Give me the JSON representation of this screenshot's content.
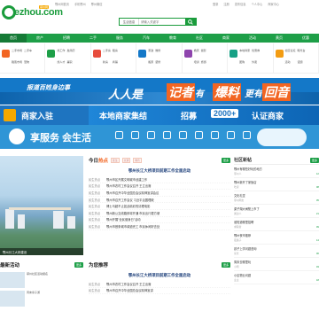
{
  "header": {
    "logo_text": "ezhou.com",
    "logo_tag": "鄂州网",
    "top_left": [
      "鄂州网首页",
      "手机鄂州",
      "鄂州微信"
    ],
    "top_right": [
      "登录",
      "注册",
      "发布信息",
      "个人中心",
      "商家中心"
    ]
  },
  "search": {
    "scope": "生活信息",
    "placeholder": "请输入关键字",
    "button_icon": "search-icon"
  },
  "nav": {
    "items": [
      "首页",
      "房产",
      "招聘",
      "二手",
      "服务",
      "汽车",
      "教育",
      "社区",
      "商家",
      "活动",
      "黄页",
      "优惠"
    ],
    "active_index": 0
  },
  "icon_groups": [
    {
      "color": "#f26522",
      "links": [
        "二手市场",
        "二手车",
        "跳蚤市场",
        "宠物"
      ]
    },
    {
      "color": "#1e9f48",
      "links": [
        "找工作",
        "发简历",
        "找人才",
        "兼职"
      ]
    },
    {
      "color": "#e74c3c",
      "links": [
        "二手房",
        "租房",
        "新房",
        "商铺"
      ]
    },
    {
      "color": "#1478c8",
      "links": [
        "家政",
        "维修",
        "搬家",
        "装修"
      ]
    },
    {
      "color": "#8e44ad",
      "links": [
        "婚庆",
        "摄影",
        "培训",
        "旅游"
      ]
    },
    {
      "color": "#16a085",
      "links": [
        "本地商家",
        "优惠券",
        "团购",
        "外卖"
      ]
    },
    {
      "color": "#f39c12",
      "links": [
        "社区论坛",
        "曝光台",
        "活动",
        "话题"
      ]
    }
  ],
  "banner1": {
    "t1": "报道百姓身边事",
    "t2": "人人是",
    "t3": "记者",
    "t4": "有",
    "t5": "爆料",
    "t6": "更有",
    "t7": "回音"
  },
  "banner2": {
    "b1": "商家入驻",
    "m1": "本地商家集结",
    "m2": "招募",
    "m3": "2000+",
    "m4": "认证商家"
  },
  "banner3": {
    "title": "享服务 会生活"
  },
  "hero": {
    "caption": "鄂州长江大桥建设"
  },
  "today": {
    "title_pre": "今日",
    "title_hl": "热点",
    "chips": [
      "民生",
      "交通",
      "教育"
    ],
    "more_label": "更多",
    "headline": "鄂州长江大桥项目前期工作全面启动",
    "items": [
      {
        "cat": "民生热点",
        "title": "鄂州市区开展文明城市创建工作"
      },
      {
        "cat": "民生热点",
        "title": "鄂州市农村工作会议召开 王立出席"
      },
      {
        "cat": "民生热点",
        "title": "鄂州市召开中华全国总会议精神宣讲会议"
      },
      {
        "cat": "民生热点",
        "title": "鄂州市召开工作会议 习近平治国理政"
      },
      {
        "cat": "民生热点",
        "title": "博士马超不止如此精彩的清理电影"
      },
      {
        "cat": "民生热点",
        "title": "鄂州新公交线路即将开通 市民出行更方便"
      },
      {
        "cat": "民生热点",
        "title": "鄂州开展\"全民健身日\"活动"
      },
      {
        "cat": "民生热点",
        "title": "鄂州市首条城市绿道完工 市民休闲好去处"
      }
    ]
  },
  "recommend": {
    "title": "为您推荐",
    "more_label": "更多",
    "headline": "鄂州长江大桥项目前期工作全面启动",
    "items": [
      {
        "cat": "民生热点",
        "title": "鄂州市农村工作会议召开 王立出席"
      },
      {
        "cat": "民生热点",
        "title": "鄂州市召开中华全国总会议精神宣讲"
      }
    ]
  },
  "latest": {
    "title": "最新活动",
    "more_label": "更多",
    "items": [
      {
        "text": "鄂州社区活动报名"
      },
      {
        "text": "周末亲子游"
      }
    ]
  },
  "community": {
    "title": "社区新帖",
    "more_label": "更多",
    "posts": [
      {
        "q": "鄂州有哪些好玩的地方",
        "user": "鄂州人",
        "n": "12"
      },
      {
        "q": "鄂州新开了家饭店",
        "user": "吃货",
        "n": "08"
      },
      {
        "q": "文化礼堂",
        "user": "鄂州网友",
        "n": "05"
      },
      {
        "q": "梁子湖大闸蟹上市了",
        "user": "湖边人",
        "n": "21"
      },
      {
        "q": "谁知道哪里招聘",
        "user": "求职者",
        "n": "09"
      },
      {
        "q": "鄂州夜市推荐",
        "user": "夜猫子",
        "n": "14"
      },
      {
        "q": "孩子上学问题咨询",
        "user": "家长",
        "n": "06"
      },
      {
        "q": "周末去哪里玩",
        "user": "小明",
        "n": "03"
      },
      {
        "q": "小区物业问题",
        "user": "业主",
        "n": "18"
      }
    ]
  }
}
